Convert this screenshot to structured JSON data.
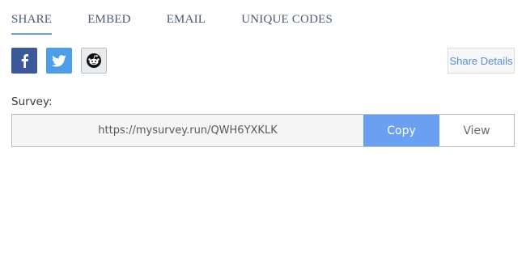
{
  "tabs": [
    {
      "label": "SHARE",
      "active": true
    },
    {
      "label": "EMBED",
      "active": false
    },
    {
      "label": "EMAIL",
      "active": false
    },
    {
      "label": "UNIQUE CODES",
      "active": false
    }
  ],
  "social": {
    "icons": [
      "facebook-icon",
      "twitter-icon",
      "reddit-icon"
    ],
    "colors": {
      "facebook": "#3b5998",
      "twitter": "#4d9ee6",
      "reddit_bg": "#e9ecef"
    }
  },
  "share_details_label": "Share Details",
  "survey": {
    "label": "Survey:",
    "url": "https://mysurvey.run/QWH6YXKLK",
    "copy_label": "Copy",
    "view_label": "View"
  },
  "colors": {
    "accent": "#6b9ff2",
    "tab_text": "#4a5a72",
    "link": "#5b8ed6"
  }
}
